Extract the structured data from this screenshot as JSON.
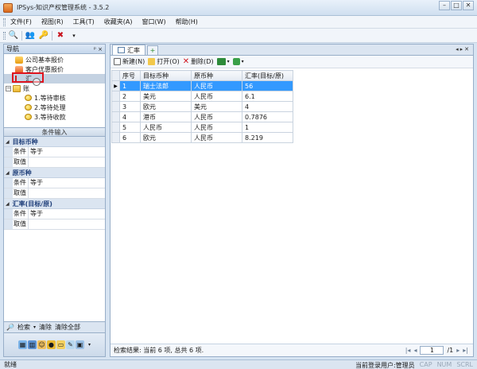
{
  "window": {
    "title": "IPSys-知识产权管理系统 - 3.5.2",
    "controls": [
      "–",
      "□",
      "✕"
    ]
  },
  "menu": [
    "文件(F)",
    "视图(R)",
    "工具(T)",
    "收藏夹(A)",
    "窗口(W)",
    "帮助(H)"
  ],
  "nav": {
    "header": "导航",
    "pin": "ᵖ ×",
    "items": [
      {
        "label": "公司基本报价"
      },
      {
        "label": "客户优惠报价"
      },
      {
        "label": "汇"
      },
      {
        "label": "账"
      },
      {
        "label": "1.等待审核"
      },
      {
        "label": "2.等待处理"
      },
      {
        "label": "3.等待收款"
      }
    ]
  },
  "conditions": {
    "header": "条件输入",
    "groups": [
      {
        "title": "目标币种",
        "rows": [
          {
            "name": "条件",
            "value": "等于"
          },
          {
            "name": "取值",
            "value": ""
          }
        ]
      },
      {
        "title": "原币种",
        "rows": [
          {
            "name": "条件",
            "value": "等于"
          },
          {
            "name": "取值",
            "value": ""
          }
        ]
      },
      {
        "title": "汇率(目标/原)",
        "rows": [
          {
            "name": "条件",
            "value": "等于"
          },
          {
            "name": "取值",
            "value": ""
          }
        ]
      }
    ]
  },
  "left_actions": {
    "search": "检索",
    "clear": "清除",
    "clear_all": "清除全部"
  },
  "tab": {
    "label": "汇率"
  },
  "doc_toolbar": {
    "new": "新建(N)",
    "open": "打开(O)",
    "delete": "删除(D)"
  },
  "table": {
    "columns": [
      "序号",
      "目标币种",
      "原币种",
      "汇率(目标/原)"
    ],
    "rows": [
      [
        "1",
        "瑞士法郎",
        "人民币",
        "56"
      ],
      [
        "2",
        "美元",
        "人民币",
        "6.1"
      ],
      [
        "3",
        "欧元",
        "美元",
        "4"
      ],
      [
        "4",
        "港币",
        "人民币",
        "0.7876"
      ],
      [
        "5",
        "人民币",
        "人民币",
        "1"
      ],
      [
        "6",
        "欧元",
        "人民币",
        "8.219"
      ]
    ],
    "selected_row_marker": "▶"
  },
  "result": {
    "text": "检索结果: 当前 6 项, 总共 6 项.",
    "page": "1",
    "total_pages": "/1"
  },
  "status": {
    "left": "就绪",
    "user": "当前登录用户:管理员",
    "caps": "CAP",
    "num": "NUM",
    "scrl": "SCRL"
  }
}
